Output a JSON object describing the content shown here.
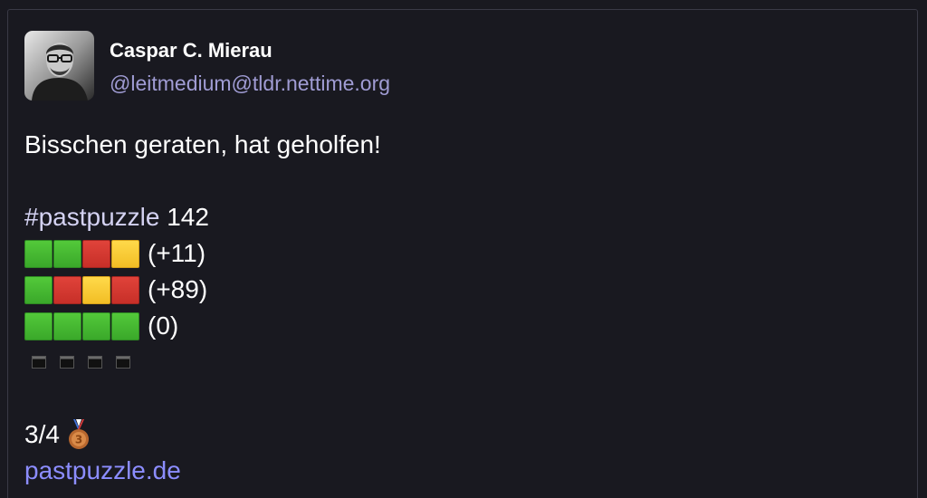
{
  "post": {
    "display_name": "Caspar C. Mierau",
    "handle": "@leitmedium@tldr.nettime.org",
    "avatar_icon": "user-avatar-photo"
  },
  "content": {
    "line1": "Bisschen geraten, hat geholfen!",
    "hashtag": "#pastpuzzle",
    "puzzle_number": "142",
    "rows": [
      {
        "squares": [
          "green",
          "green",
          "red",
          "yellow"
        ],
        "score": "(+11)"
      },
      {
        "squares": [
          "green",
          "red",
          "yellow",
          "red"
        ],
        "score": "(+89)"
      },
      {
        "squares": [
          "green",
          "green",
          "green",
          "green"
        ],
        "score": "(0)"
      }
    ],
    "empty_row_count": 4,
    "result": "3/4",
    "medal_icon": "bronze-medal-icon",
    "medal_number": "3",
    "link": "pastpuzzle.de"
  },
  "colors": {
    "background": "#191920",
    "green": "#3fb52f",
    "red": "#d3362f",
    "yellow": "#f7c733",
    "link": "#8c8dff",
    "handle": "#a09cd4"
  }
}
